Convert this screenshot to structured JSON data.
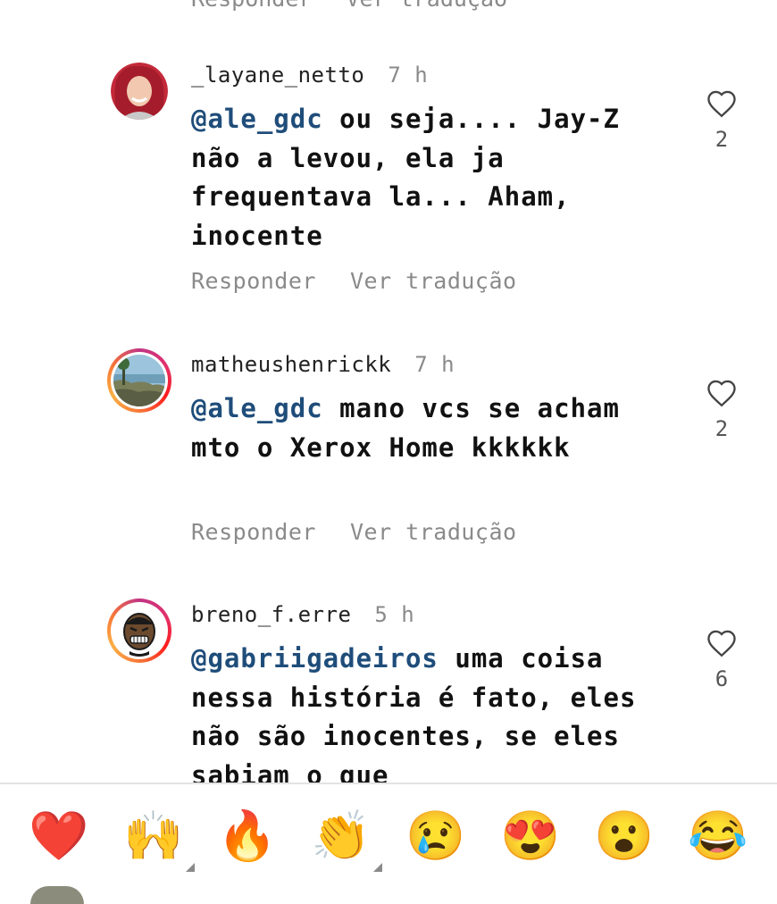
{
  "previous_comment_actions": {
    "reply": "Responder",
    "translate": "Ver tradução"
  },
  "comments": [
    {
      "username": "_layane_netto",
      "time": "7 h",
      "mention": "@ale_gdc",
      "text": " ou seja.... Jay-Z não a levou, ela ja frequentava la... Aham, inocente",
      "reply": "Responder",
      "translate": "Ver tradução",
      "likes": "2"
    },
    {
      "username": "matheushenrickk",
      "time": "7 h",
      "mention": "@ale_gdc",
      "text": " mano vcs se acham mto o Xerox Home kkkkkk",
      "reply": "Responder",
      "translate": "Ver tradução",
      "likes": "2"
    },
    {
      "username": "breno_f.erre",
      "time": "5 h",
      "mention": "@gabriigadeiros",
      "text": " uma coisa nessa história é fato, eles não são inocentes, se eles sabiam o que",
      "likes": "6"
    }
  ],
  "emoji_bar": [
    {
      "name": "red-heart",
      "glyph": "❤️"
    },
    {
      "name": "raising-hands",
      "glyph": "🙌"
    },
    {
      "name": "fire",
      "glyph": "🔥"
    },
    {
      "name": "clapping-hands",
      "glyph": "👏"
    },
    {
      "name": "crying-face",
      "glyph": "😢"
    },
    {
      "name": "heart-eyes",
      "glyph": "😍"
    },
    {
      "name": "surprised-face",
      "glyph": "😮"
    },
    {
      "name": "tears-of-joy",
      "glyph": "😂"
    }
  ],
  "icons": {
    "like": "heart-outline-icon"
  },
  "colors": {
    "mention": "#1f4d7a",
    "muted": "#8a8a8a",
    "story_ring": "#e1306c"
  }
}
